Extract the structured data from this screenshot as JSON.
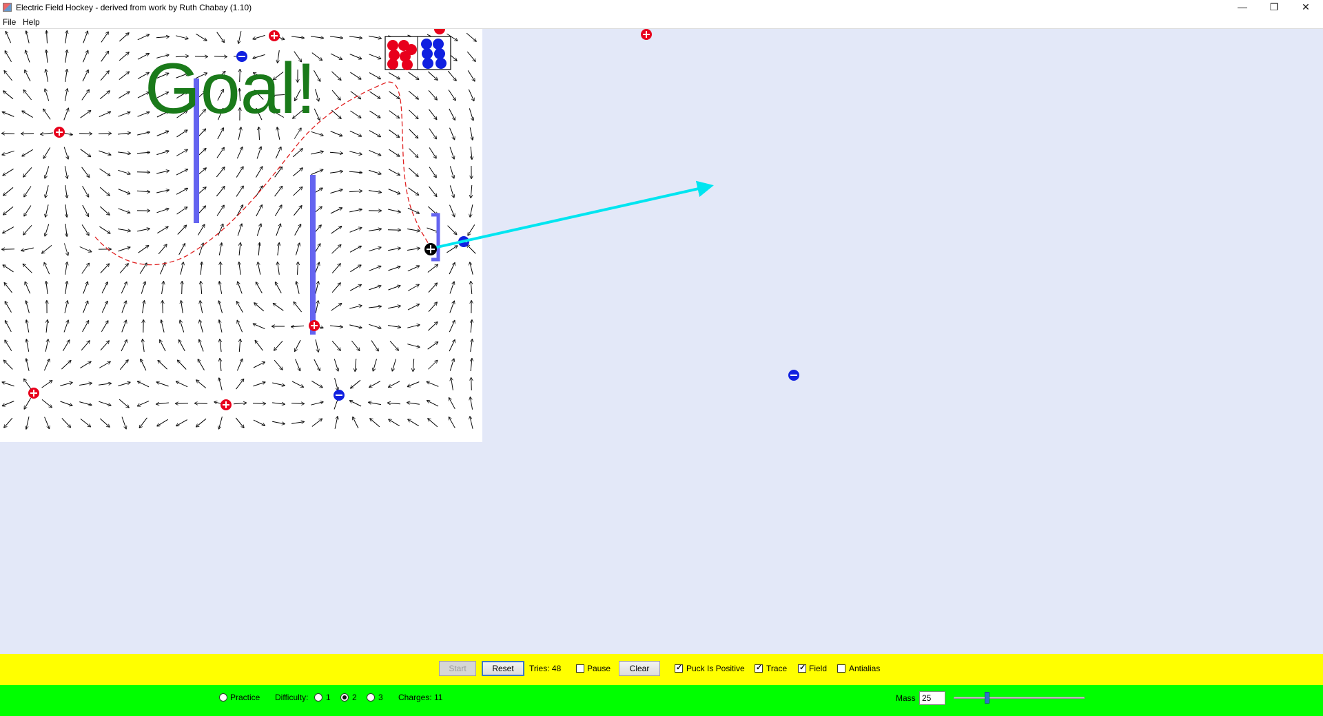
{
  "window": {
    "title": "Electric Field Hockey - derived from work by Ruth Chabay (1.10)",
    "controls": {
      "minimize": "—",
      "maximize": "❐",
      "close": "✕"
    }
  },
  "menu": {
    "items": [
      "File",
      "Help"
    ]
  },
  "game": {
    "goal_text": "Goal!",
    "colors": {
      "background": "#e3e8f8",
      "positive": "#e8001c",
      "negative": "#1020e0",
      "wall": "#6464f0",
      "goal_text": "#1a7a1a",
      "velocity_arrow": "#00e5f0",
      "trace": "#e02020"
    },
    "puck": {
      "sign": "positive"
    },
    "charges": [
      {
        "sign": "positive"
      },
      {
        "sign": "positive"
      },
      {
        "sign": "positive"
      },
      {
        "sign": "positive"
      },
      {
        "sign": "positive"
      },
      {
        "sign": "positive"
      },
      {
        "sign": "positive"
      },
      {
        "sign": "negative"
      },
      {
        "sign": "negative"
      },
      {
        "sign": "negative"
      },
      {
        "sign": "negative"
      }
    ]
  },
  "controls": {
    "start_label": "Start",
    "reset_label": "Reset",
    "tries_label": "Tries: 48",
    "pause_label": "Pause",
    "clear_label": "Clear",
    "puck_positive_label": "Puck Is Positive",
    "trace_label": "Trace",
    "field_label": "Field",
    "antialias_label": "Antialias",
    "pause_checked": false,
    "puck_positive_checked": true,
    "trace_checked": true,
    "field_checked": true,
    "antialias_checked": false
  },
  "settings": {
    "practice_label": "Practice",
    "difficulty_label": "Difficulty:",
    "difficulty_options": [
      "1",
      "2",
      "3"
    ],
    "difficulty_selected": "2",
    "charges_label": "Charges: 11",
    "mass_label": "Mass",
    "mass_value": "25",
    "mass_slider_fraction": 0.25
  }
}
